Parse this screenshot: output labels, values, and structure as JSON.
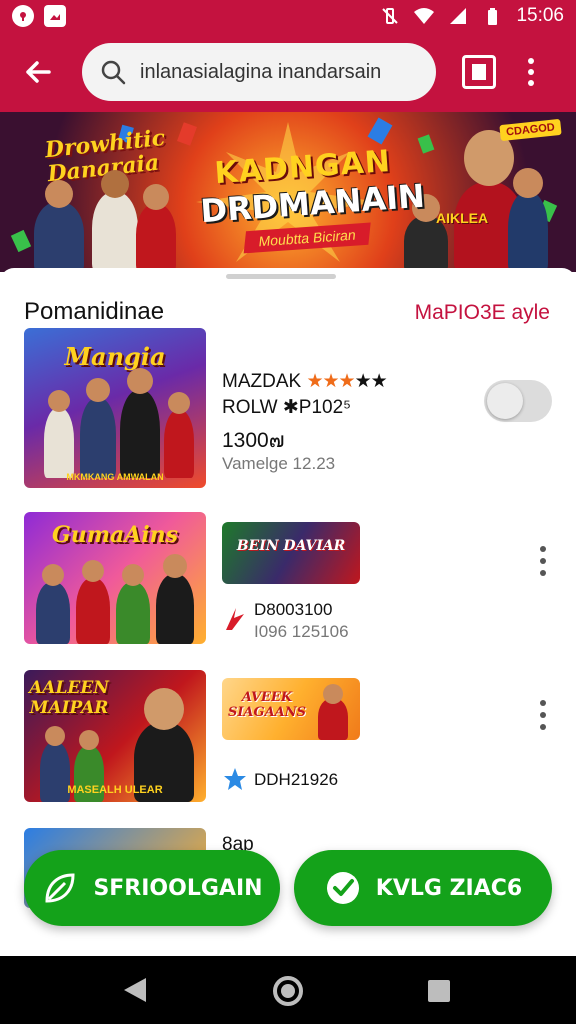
{
  "status_bar": {
    "time": "15:06"
  },
  "app_bar": {
    "search_value": "inlanasialagina inandarsain",
    "accent_color": "#c4123f"
  },
  "banner": {
    "left_logo_line1": "Drowhitic",
    "left_logo_line2": "Danaraia",
    "title_line1": "KADNGAN",
    "title_line2": "DRDMANAIN",
    "title_tagline": "Moubtta Biciran",
    "right_badge": "CDAGOD",
    "right_lower_label": "AIKLEA"
  },
  "section": {
    "title": "Pomanidinae",
    "link": "MaPIO3E ayle"
  },
  "items": [
    {
      "thumb_title": "Mangia",
      "thumb_sub": "MKMKANG AMWALAN",
      "line1": "MAZDAK",
      "stars_filled": 3,
      "stars_total": 5,
      "line2": "ROLW ✱P102⁵",
      "line3": "1300๗",
      "meta": "Vamelge 12.23",
      "toggle_on": false
    },
    {
      "thumb_title": "GumaAins",
      "mini_title": "BEIN DAVIAR",
      "line1": "D8003100",
      "line2": "I096 125106"
    },
    {
      "thumb_title": "AALEEN MAIPAR",
      "thumb_sub": "MASEALH ULEAR",
      "mini_title": "AVEEK SIAGAANS",
      "line1": "DDH21926"
    },
    {
      "line1": "8ap"
    }
  ],
  "buttons": {
    "left": "SFRIOOLGAIN",
    "right": "KVLG ZIAC6",
    "color": "#14a21a"
  }
}
